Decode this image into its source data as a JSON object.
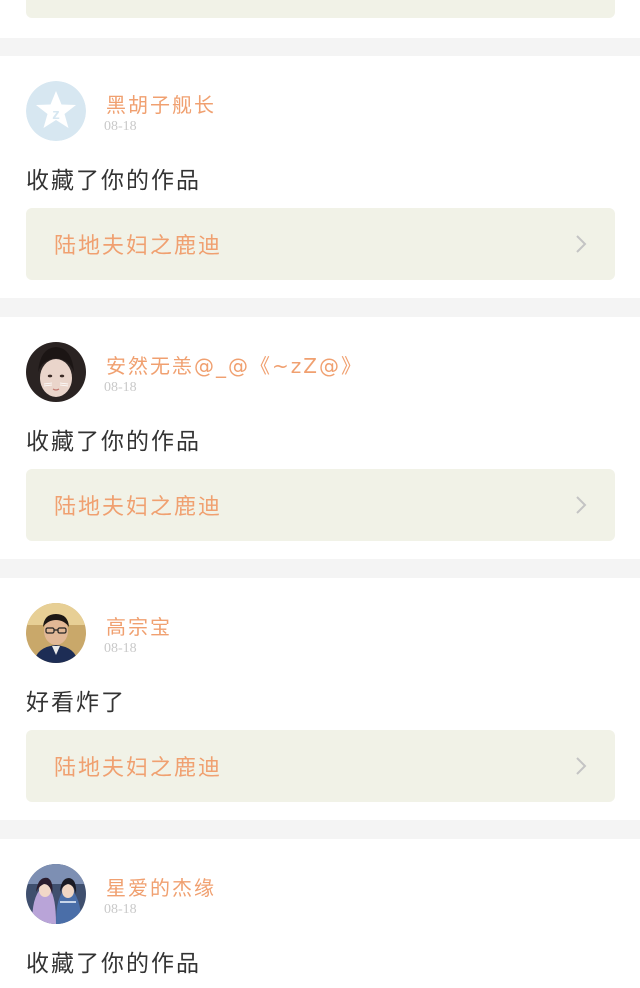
{
  "colors": {
    "accent": "#f0a070",
    "background": "#f4f4f4",
    "card": "#ffffff",
    "work_box": "#f1f2e7",
    "date": "#c9c9c9",
    "text": "#333333"
  },
  "top_partial": {
    "work_title": ""
  },
  "items": [
    {
      "user": "黑胡子舰长",
      "date": "08-18",
      "message": "收藏了你的作品",
      "work_title": "陆地夫妇之鹿迪",
      "avatar_icon": "qzone-logo-icon"
    },
    {
      "user": "安然无恙@_@《~zZ@》",
      "date": "08-18",
      "message": "收藏了你的作品",
      "work_title": "陆地夫妇之鹿迪",
      "avatar_icon": "girl-photo-avatar"
    },
    {
      "user": "高宗宝",
      "date": "08-18",
      "message": "好看炸了",
      "work_title": "陆地夫妇之鹿迪",
      "avatar_icon": "boy-glasses-photo-avatar"
    },
    {
      "user": "星爱的杰缘",
      "date": "08-18",
      "message": "收藏了你的作品",
      "work_title": "",
      "avatar_icon": "anime-couple-avatar"
    }
  ]
}
